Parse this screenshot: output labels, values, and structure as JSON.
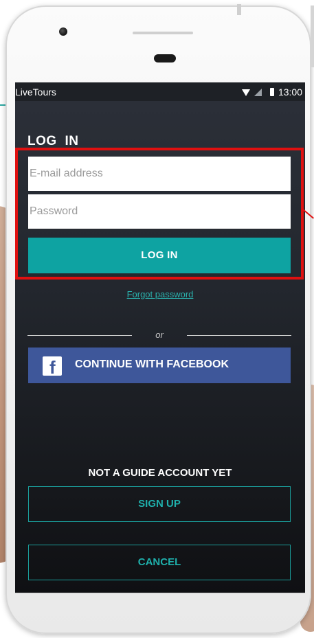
{
  "status_bar": {
    "app_name": "LiveTours",
    "time": "13:00",
    "icons": [
      "wifi-icon",
      "signal-icon",
      "battery-icon"
    ]
  },
  "login": {
    "heading": "LOG IN",
    "email_placeholder": "E-mail address",
    "password_placeholder": "Password",
    "submit_label": "LOG IN",
    "forgot_label": "Forgot password"
  },
  "divider": {
    "label": "or"
  },
  "facebook": {
    "label": "CONTINUE WITH FACEBOOK",
    "icon": "facebook-icon",
    "icon_glyph": "f"
  },
  "signup_section": {
    "prompt": "NOT A GUIDE ACCOUNT YET",
    "signup_label": "SIGN UP",
    "cancel_label": "CANCEL"
  },
  "colors": {
    "accent": "#0ea3a2",
    "facebook": "#3e579a",
    "highlight": "#e01010",
    "screen_bg": "#23272e"
  }
}
